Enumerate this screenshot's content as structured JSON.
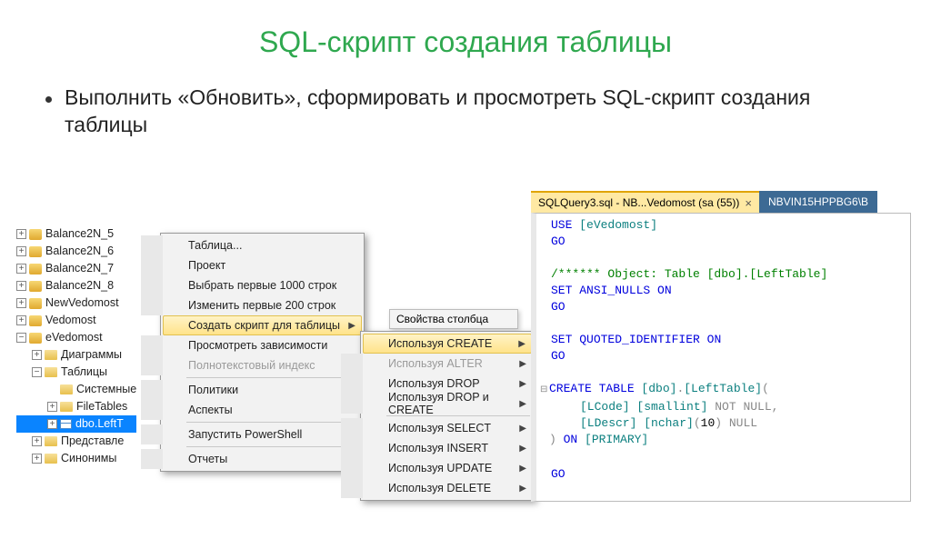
{
  "title": "SQL-скрипт создания таблицы",
  "bullet": "Выполнить «Обновить», сформировать и просмотреть SQL-скрипт создания таблицы",
  "tree": {
    "items": [
      {
        "pm": "+",
        "ico": "db",
        "label": "Balance2N_5",
        "ind": 0
      },
      {
        "pm": "+",
        "ico": "db",
        "label": "Balance2N_6",
        "ind": 0
      },
      {
        "pm": "+",
        "ico": "db",
        "label": "Balance2N_7",
        "ind": 0
      },
      {
        "pm": "+",
        "ico": "db",
        "label": "Balance2N_8",
        "ind": 0
      },
      {
        "pm": "+",
        "ico": "db",
        "label": "NewVedomost",
        "ind": 0
      },
      {
        "pm": "+",
        "ico": "db",
        "label": "Vedomost",
        "ind": 0
      },
      {
        "pm": "−",
        "ico": "db",
        "label": "eVedomost",
        "ind": 0
      },
      {
        "pm": "+",
        "ico": "folder",
        "label": "Диаграммы",
        "ind": 1
      },
      {
        "pm": "−",
        "ico": "folder",
        "label": "Таблицы",
        "ind": 1
      },
      {
        "pm": "",
        "ico": "folder",
        "label": "Системные",
        "ind": 2
      },
      {
        "pm": "+",
        "ico": "folder",
        "label": "FileTables",
        "ind": 2
      },
      {
        "pm": "+",
        "ico": "table",
        "label": "dbo.LeftT",
        "ind": 2,
        "sel": true
      },
      {
        "pm": "+",
        "ico": "folder",
        "label": "Представле",
        "ind": 1
      },
      {
        "pm": "+",
        "ico": "folder",
        "label": "Синонимы",
        "ind": 1
      }
    ]
  },
  "menu1": {
    "items": [
      {
        "label": "Таблица..."
      },
      {
        "label": "Проект"
      },
      {
        "label": "Выбрать первые 1000 строк"
      },
      {
        "label": "Изменить первые 200 строк"
      },
      {
        "label": "Создать скрипт для таблицы",
        "hov": true,
        "sub": true
      },
      {
        "label": "Просмотреть зависимости"
      },
      {
        "label": "Полнотекстовый индекс",
        "dis": true,
        "sub": true
      },
      {
        "sep": true
      },
      {
        "label": "Политики",
        "sub": true
      },
      {
        "label": "Аспекты"
      },
      {
        "sep": true
      },
      {
        "label": "Запустить PowerShell"
      },
      {
        "sep": true
      },
      {
        "label": "Отчеты",
        "sub": true
      }
    ]
  },
  "menu2": {
    "items": [
      {
        "label": "Используя CREATE",
        "hov": true,
        "sub": true
      },
      {
        "label": "Используя ALTER",
        "dis": true,
        "sub": true
      },
      {
        "label": "Используя DROP",
        "sub": true
      },
      {
        "label": "Используя DROP и CREATE",
        "sub": true
      },
      {
        "sep": true
      },
      {
        "label": "Используя SELECT",
        "sub": true
      },
      {
        "label": "Используя INSERT",
        "sub": true
      },
      {
        "label": "Используя UPDATE",
        "sub": true
      },
      {
        "label": "Используя DELETE",
        "sub": true
      }
    ]
  },
  "colprops": "Свойства столбца",
  "tabs": {
    "active": "SQLQuery3.sql - NB...Vedomost (sa (55))",
    "inactive": "NBVIN15HPPBG6\\B"
  },
  "code": {
    "l1a": "USE ",
    "l1b": "[eVedomost]",
    "l2": "GO",
    "l3": "/****** Object:  Table [dbo].[LeftTable]",
    "l4a": "SET ",
    "l4b": "ANSI_NULLS ",
    "l4c": "ON",
    "l5": "GO",
    "l6a": "SET ",
    "l6b": "QUOTED_IDENTIFIER ",
    "l6c": "ON",
    "l7": "GO",
    "l8a": "CREATE ",
    "l8b": "TABLE ",
    "l8c": "[dbo]",
    "l8d": ".",
    "l8e": "[LeftTable]",
    "l8f": "(",
    "l9a": "[LCode] [smallint] ",
    "l9b": "NOT NULL",
    "l9c": ",",
    "l10a": "[LDescr] [nchar]",
    "l10b": "(",
    "l10c": "10",
    "l10d": ") ",
    "l10e": "NULL",
    "l11a": ") ",
    "l11b": "ON ",
    "l11c": "[PRIMARY]",
    "l12": "GO"
  }
}
